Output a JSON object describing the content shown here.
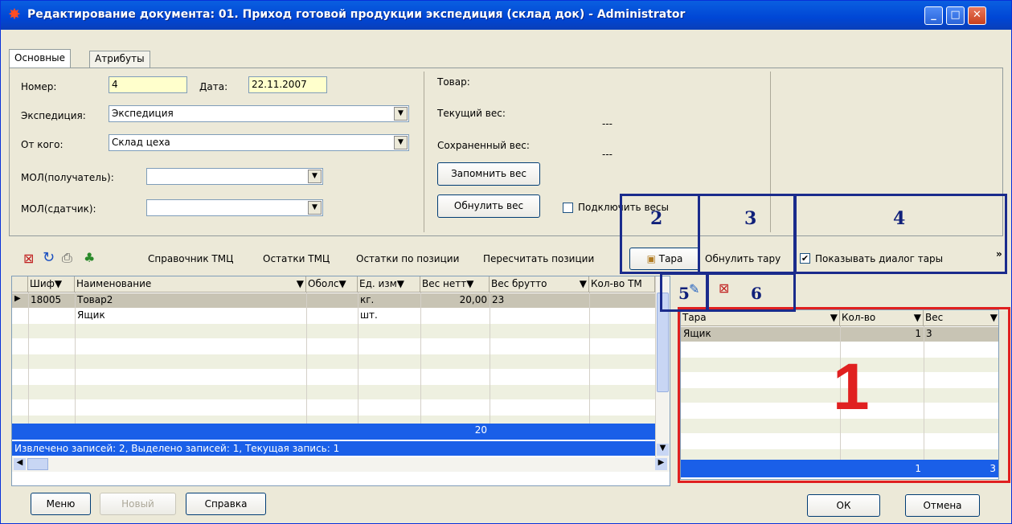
{
  "window": {
    "title": "Редактирование документа: 01. Приход готовой продукции экспедиция (склад док) - Administrator",
    "icon": "star-burst-icon",
    "min": "_",
    "max": "□",
    "close": "✕"
  },
  "tabs": [
    {
      "label": "Основные"
    },
    {
      "label": "Атрибуты"
    }
  ],
  "form": {
    "number_label": "Номер:",
    "number_value": "4",
    "date_label": "Дата:",
    "date_value": "22.11.2007",
    "expedition_label": "Экспедиция:",
    "expedition_value": "Экспедиция",
    "from_label": "От кого:",
    "from_value": "Склад цеха",
    "mol_receiver_label": "МОЛ(получатель):",
    "mol_receiver_value": "",
    "mol_sender_label": "МОЛ(сдатчик):",
    "mol_sender_value": ""
  },
  "weight": {
    "goods_label": "Товар:",
    "current_label": "Текущий вес:",
    "current_value": "---",
    "saved_label": "Сохраненный вес:",
    "saved_value": "---",
    "remember_button": "Запомнить вес",
    "reset_button": "Обнулить вес",
    "connect_scales_label": "Подключить весы"
  },
  "toolbar": {
    "items": [
      "Справочник ТМЦ",
      "Остатки ТМЦ",
      "Остатки по позиции",
      "Пересчитать позиции"
    ],
    "tara_button": "Тара",
    "reset_tara": "Обнулить тару",
    "show_tara_dialog": "Показывать диалог тары",
    "more": "»"
  },
  "left_grid": {
    "columns": [
      "Шиф",
      "Наименование",
      "Оболс",
      "Ед. изм",
      "Вес нетт",
      "Вес брутто",
      "Кол-во ТМ"
    ],
    "rows": [
      {
        "code": "18005",
        "name": "Товар2",
        "unit": "кг.",
        "net": "20,00",
        "gross": "23"
      },
      {
        "code": "",
        "name": "Ящик",
        "unit": "шт.",
        "net": "",
        "gross": ""
      }
    ],
    "total_net": "20",
    "status": "Извлечено записей: 2, Выделено записей: 1, Текущая запись: 1"
  },
  "right_grid": {
    "columns": [
      "Тара",
      "Кол-во",
      "Вес"
    ],
    "rows": [
      {
        "tara": "Ящик",
        "qty": "1",
        "weight": "3"
      }
    ],
    "total_qty": "1",
    "total_weight": "3"
  },
  "annotations": {
    "n1": "1",
    "n2": "2",
    "n3": "3",
    "n4": "4",
    "n5": "5",
    "n6": "6"
  },
  "bottom": {
    "menu": "Меню",
    "new": "Новый",
    "help": "Справка",
    "ok": "ОК",
    "cancel": "Отмена"
  },
  "colors": {
    "title_blue": "#0046d5",
    "selection_blue": "#1a5fe8",
    "annotation_red": "#e02020",
    "annotation_navy": "#1a2b8c",
    "input_yellow": "#ffffcc"
  }
}
